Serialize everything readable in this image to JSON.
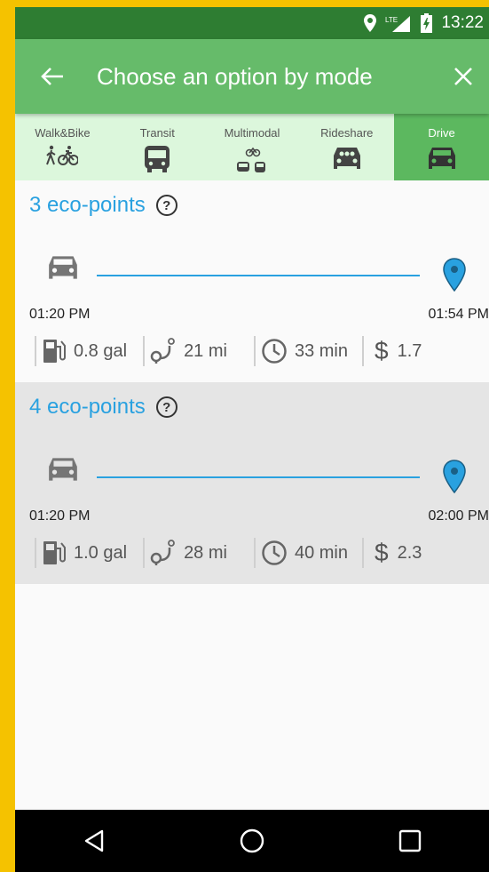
{
  "status_bar": {
    "time": "13:22",
    "network": "LTE"
  },
  "header": {
    "title": "Choose an option by mode"
  },
  "tabs": [
    {
      "label": "Walk&Bike",
      "icon": "walk-bike-icon"
    },
    {
      "label": "Transit",
      "icon": "bus-icon"
    },
    {
      "label": "Multimodal",
      "icon": "multimodal-icon"
    },
    {
      "label": "Rideshare",
      "icon": "rideshare-icon"
    },
    {
      "label": "Drive",
      "icon": "car-icon",
      "active": true
    }
  ],
  "options": [
    {
      "eco_points": "3 eco-points",
      "depart": "01:20 PM",
      "arrive": "01:54 PM",
      "fuel": "0.8 gal",
      "distance": "21 mi",
      "duration": "33 min",
      "cost": "1.7"
    },
    {
      "eco_points": "4 eco-points",
      "depart": "01:20 PM",
      "arrive": "02:00 PM",
      "fuel": "1.0 gal",
      "distance": "28 mi",
      "duration": "40 min",
      "cost": "2.3"
    }
  ],
  "colors": {
    "accent": "#29a1e0",
    "app_bar": "#66bb6a",
    "status_bar": "#2e7d32",
    "tab_bg": "#dcf7dc",
    "tab_active": "#5cb85f"
  }
}
